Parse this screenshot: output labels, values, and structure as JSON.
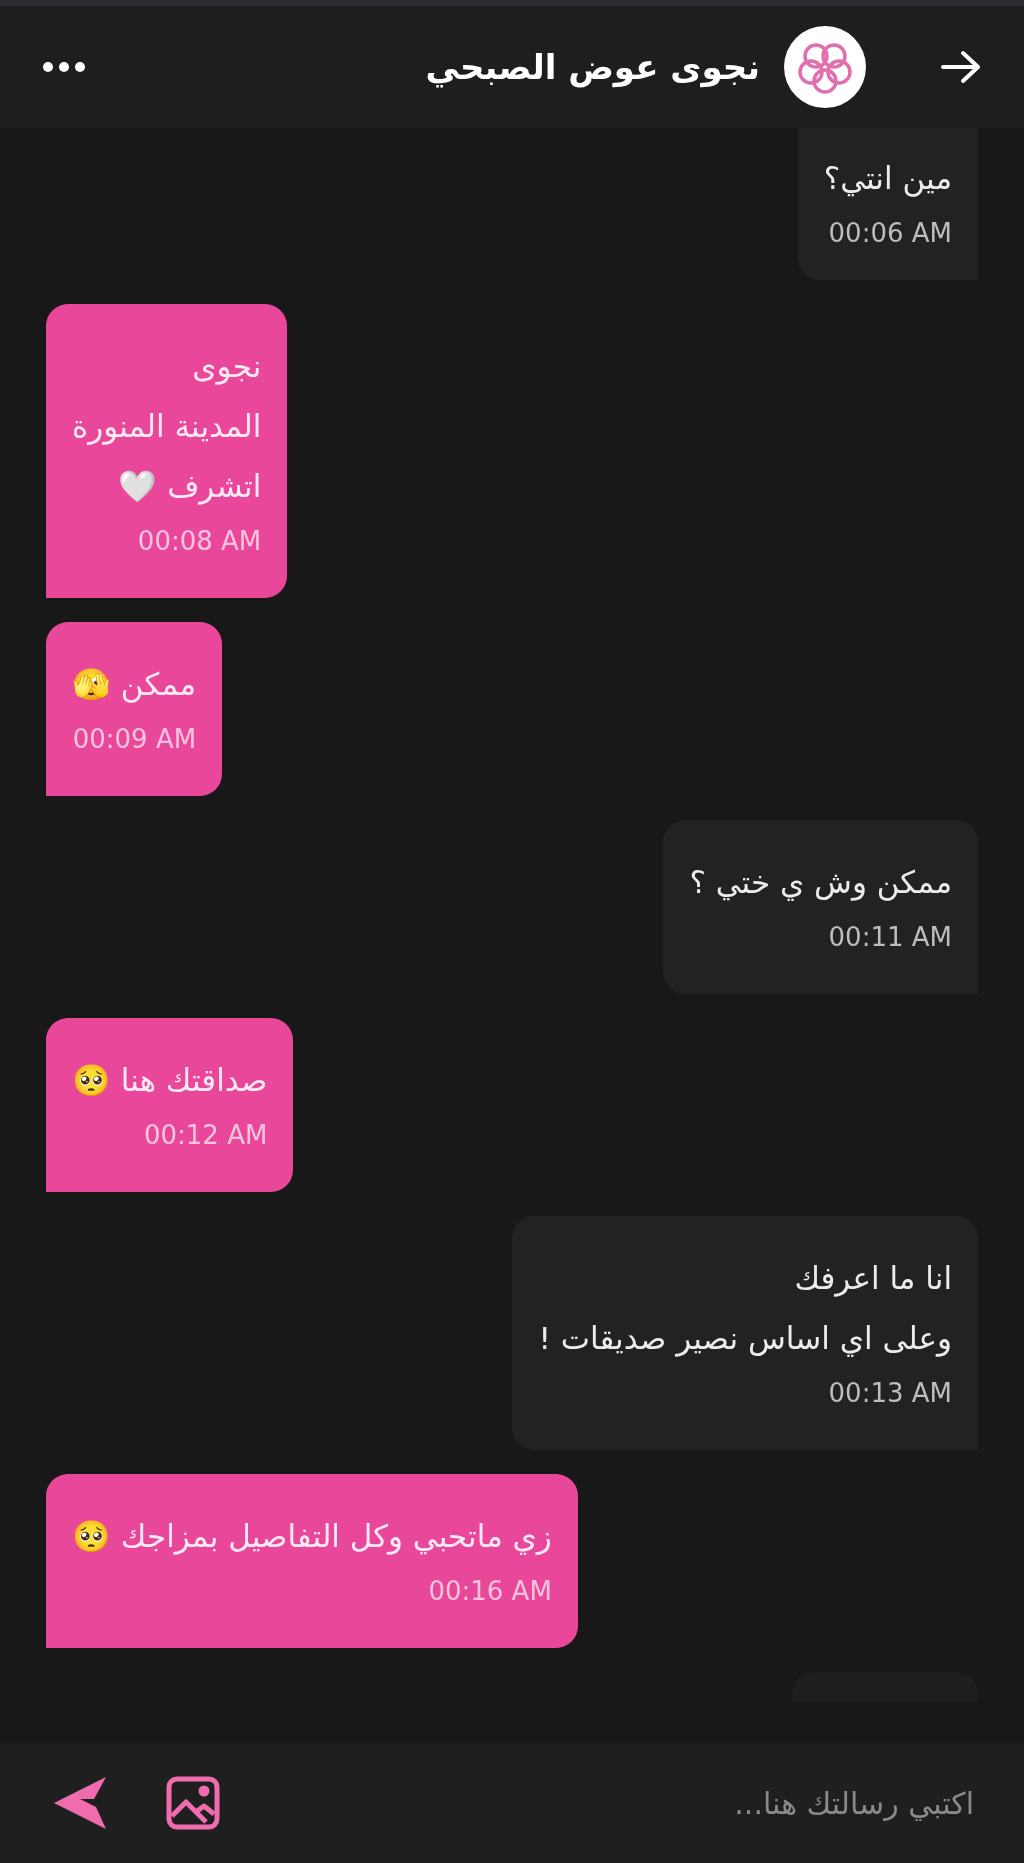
{
  "header": {
    "title": "نجوى عوض الصبحي"
  },
  "messages": [
    {
      "kind": "outgoing",
      "lines": [
        "مين انتي؟"
      ],
      "time": "00:06 AM"
    },
    {
      "kind": "incoming",
      "lines": [
        "نجوى",
        "المدينة المنورة",
        "اتشرف 🤍"
      ],
      "time": "00:08 AM"
    },
    {
      "kind": "incoming",
      "lines": [
        "ممكن 🫣"
      ],
      "time": "00:09 AM"
    },
    {
      "kind": "outgoing",
      "lines": [
        "ممكن وش ي ختي ؟"
      ],
      "time": "00:11 AM"
    },
    {
      "kind": "incoming",
      "lines": [
        "صداقتك هنا 🥺"
      ],
      "time": "00:12 AM"
    },
    {
      "kind": "outgoing",
      "lines": [
        "انا ما اعرفك",
        "وعلى اي اساس نصير صديقات !"
      ],
      "time": "00:13 AM"
    },
    {
      "kind": "incoming",
      "lines": [
        "زي ماتحبي وكل التفاصيل بمزاجك 🥺"
      ],
      "time": "00:16 AM"
    }
  ],
  "composer": {
    "placeholder": "اكتبي رسالتك هنا..."
  }
}
